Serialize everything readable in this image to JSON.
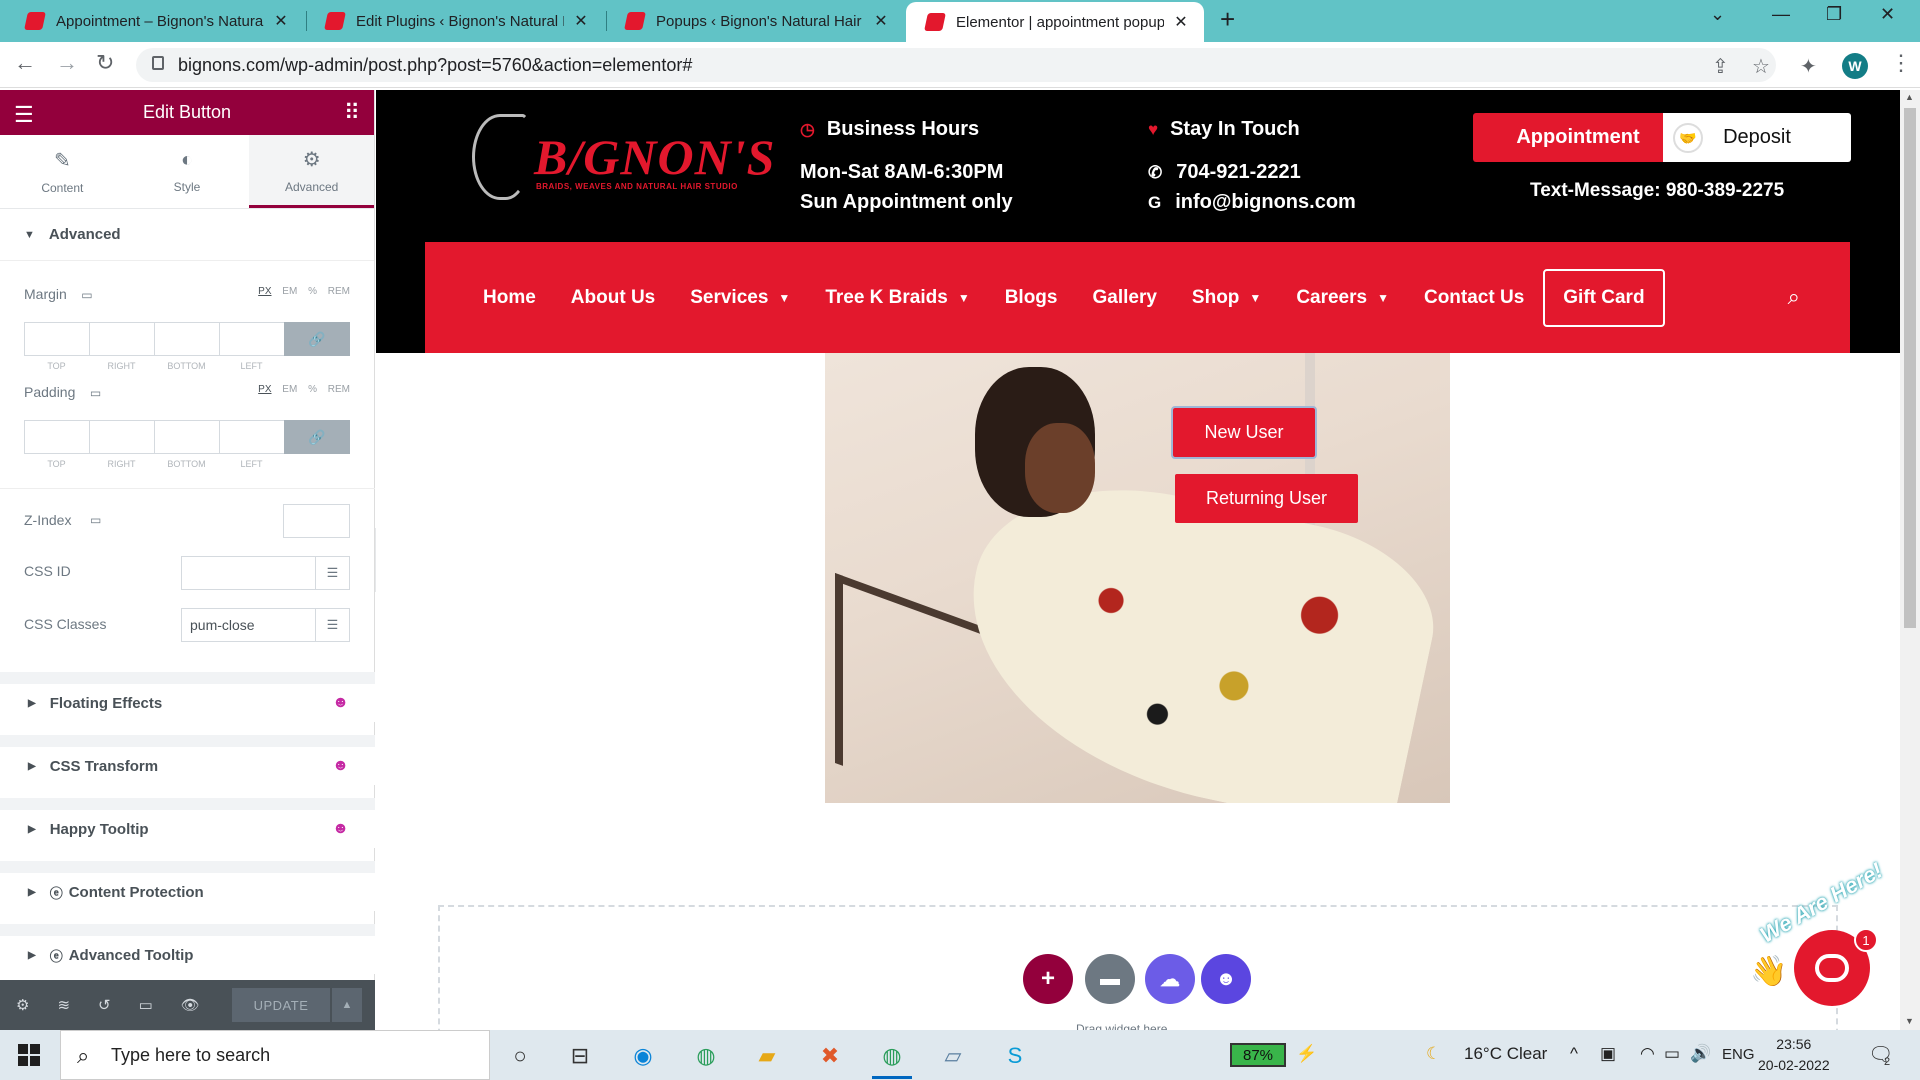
{
  "browser": {
    "tabs": [
      {
        "title": "Appointment – Bignon's Natural H",
        "active": false
      },
      {
        "title": "Edit Plugins ‹ Bignon's Natural Ha",
        "active": false
      },
      {
        "title": "Popups ‹ Bignon's Natural Hair St",
        "active": false
      },
      {
        "title": "Elementor | appointment popup",
        "active": true
      }
    ],
    "url": "bignons.com/wp-admin/post.php?post=5760&action=elementor#",
    "profile_initial": "W"
  },
  "panel": {
    "title": "Edit Button",
    "tabs": [
      {
        "label": "Content",
        "icon": "pencil-icon"
      },
      {
        "label": "Style",
        "icon": "half-circle-icon"
      },
      {
        "label": "Advanced",
        "icon": "gear-icon",
        "active": true
      }
    ],
    "section": "Advanced",
    "margin_label": "Margin",
    "padding_label": "Padding",
    "units": [
      "PX",
      "EM",
      "%",
      "REM"
    ],
    "dim_labels": [
      "TOP",
      "RIGHT",
      "BOTTOM",
      "LEFT"
    ],
    "zindex_label": "Z-Index",
    "cssid_label": "CSS ID",
    "cssclasses_label": "CSS Classes",
    "cssclasses_value": "pum-close",
    "collapsed_sections": [
      "Floating Effects",
      "CSS Transform",
      "Happy Tooltip",
      "Content Protection",
      "Advanced Tooltip"
    ],
    "update_label": "UPDATE"
  },
  "site": {
    "logo_text": "B/GNON'S",
    "logo_tagline": "BRAIDS, WEAVES AND NATURAL HAIR STUDIO",
    "hours_title": "Business Hours",
    "hours_line1": "Mon-Sat 8AM-6:30PM",
    "hours_line2": "Sun Appointment only",
    "contact_title": "Stay In Touch",
    "phone": "704-921-2221",
    "email": "info@bignons.com",
    "appointment_label": "Appointment",
    "deposit_label": "Deposit",
    "text_message": "Text-Message: 980-389-2275",
    "nav": [
      {
        "label": "Home",
        "dropdown": false
      },
      {
        "label": "About Us",
        "dropdown": false
      },
      {
        "label": "Services",
        "dropdown": true
      },
      {
        "label": "Tree K Braids",
        "dropdown": true
      },
      {
        "label": "Blogs",
        "dropdown": false
      },
      {
        "label": "Gallery",
        "dropdown": false
      },
      {
        "label": "Shop",
        "dropdown": true
      },
      {
        "label": "Careers",
        "dropdown": true
      },
      {
        "label": "Contact Us",
        "dropdown": false
      }
    ],
    "gift_card_label": "Gift Card",
    "new_user_label": "New User",
    "returning_user_label": "Returning User",
    "dropzone_label": "Drag widget here",
    "chat_badge": "1",
    "we_are_here": "We Are Here!",
    "accent_color": "#e3182d"
  },
  "taskbar": {
    "search_placeholder": "Type here to search",
    "battery": "87%",
    "weather": "16°C  Clear",
    "lang": "ENG",
    "time": "23:56",
    "date": "20-02-2022",
    "notifications": "2"
  }
}
